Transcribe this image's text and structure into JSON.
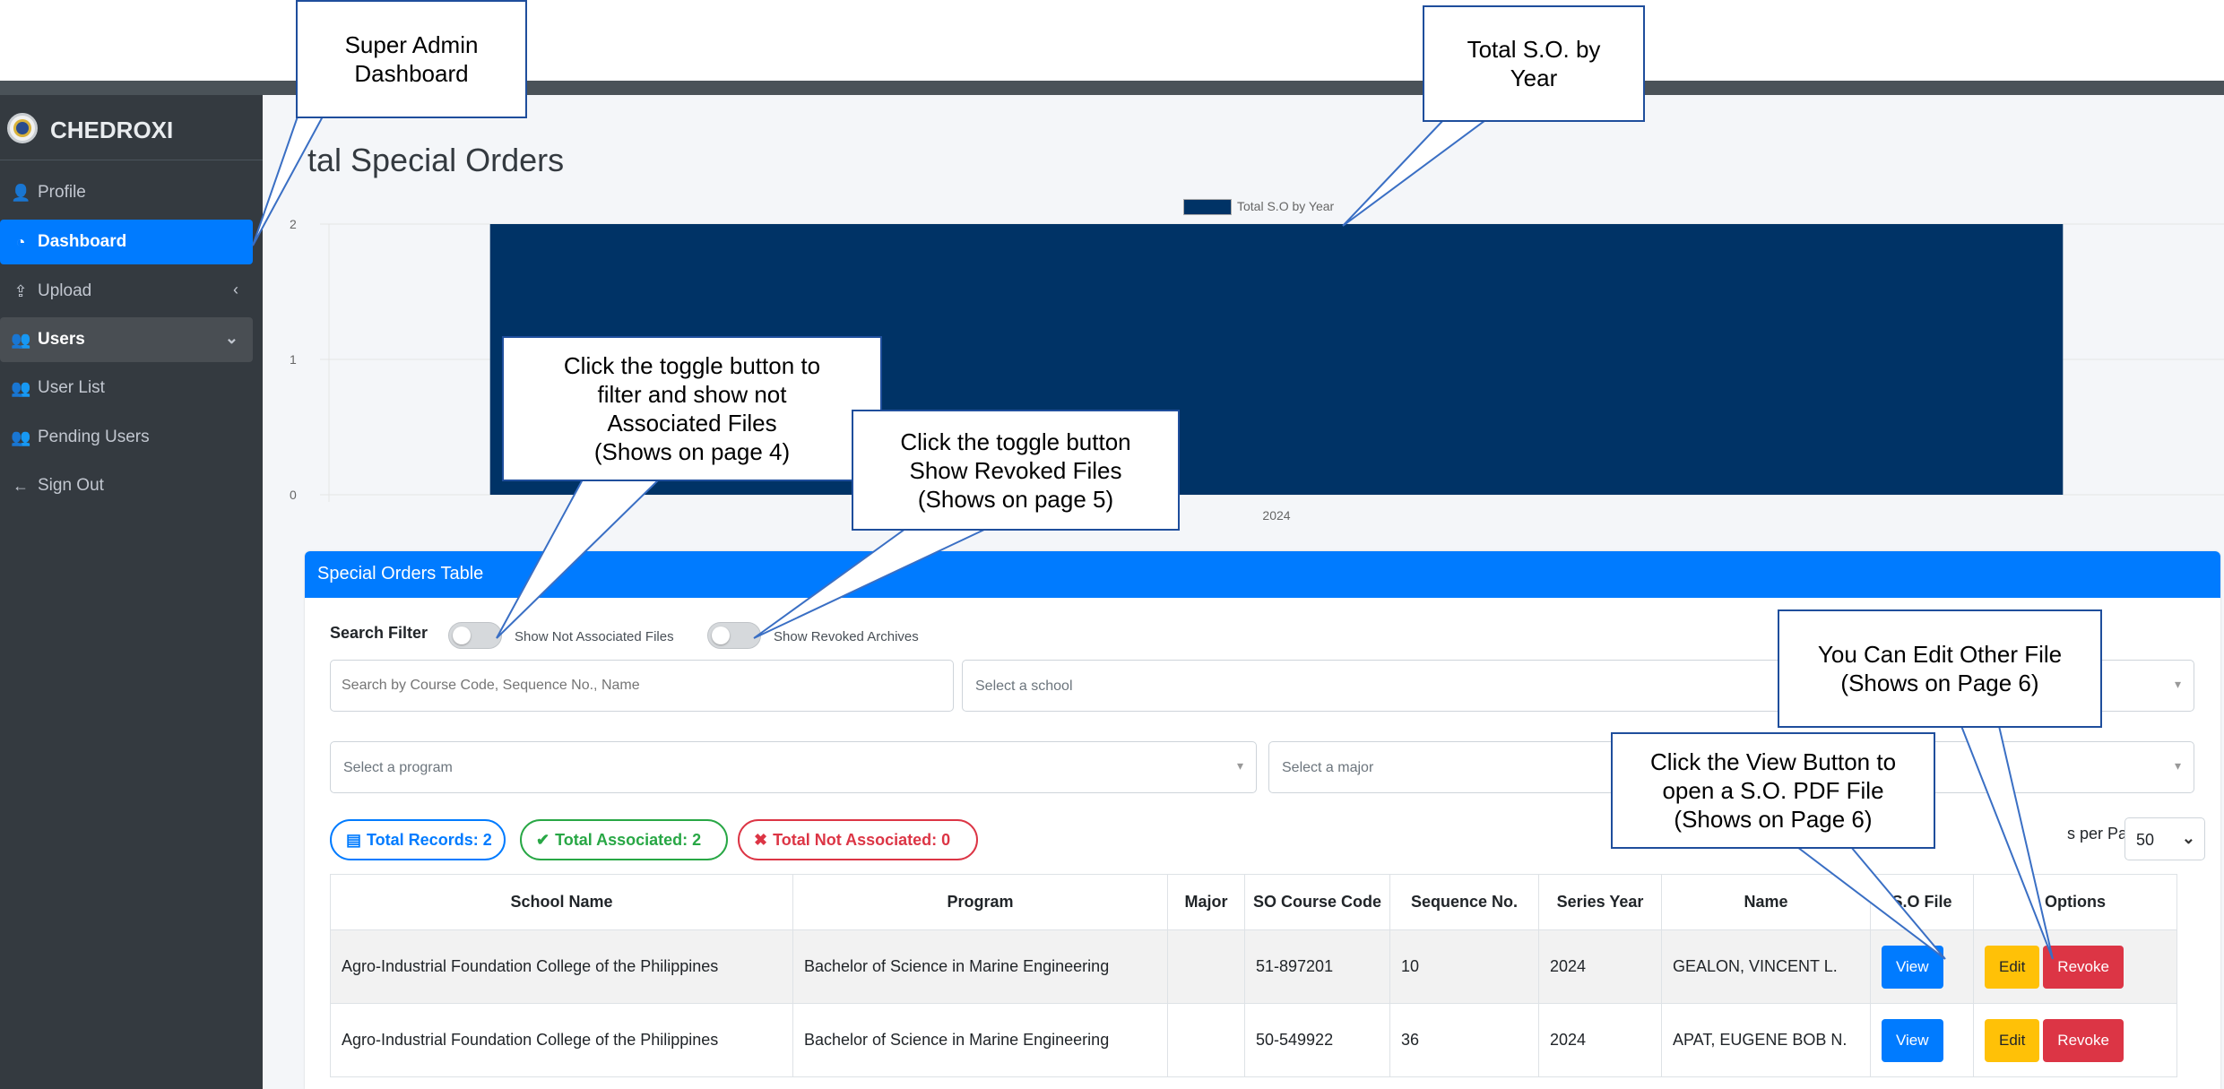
{
  "sidebar": {
    "brand": "CHEDROXI",
    "items": [
      {
        "label": "Profile",
        "icon": "user-icon",
        "glyph": "👤"
      },
      {
        "label": "Dashboard",
        "icon": "dashboard-icon",
        "glyph": "◔"
      },
      {
        "label": "Upload",
        "icon": "upload-icon",
        "glyph": "⇪"
      },
      {
        "label": "Users",
        "icon": "users-icon",
        "glyph": "👥"
      },
      {
        "label": "User List",
        "icon": "users-icon",
        "glyph": "👥"
      },
      {
        "label": "Pending Users",
        "icon": "users-icon",
        "glyph": "👥"
      },
      {
        "label": "Sign Out",
        "icon": "arrow-left-icon",
        "glyph": "←"
      }
    ]
  },
  "page": {
    "title": "tal Special Orders"
  },
  "chart_data": {
    "type": "bar",
    "categories": [
      "2024"
    ],
    "series": [
      {
        "name": "Total S.O by Year",
        "values": [
          2
        ],
        "color": "#003366"
      }
    ],
    "yticks": [
      "0",
      "1",
      "2"
    ],
    "ylim": [
      0,
      2
    ]
  },
  "card": {
    "title": "Special Orders Table"
  },
  "filters": {
    "label": "Search Filter",
    "toggle1": "Show Not Associated Files",
    "toggle2": "Show Revoked Archives",
    "search_placeholder": "Search by Course Code, Sequence No., Name",
    "school_placeholder": "Select a school",
    "program_placeholder": "Select a program",
    "major_placeholder": "Select a major"
  },
  "badges": {
    "total_records": "Total Records: 2",
    "total_associated": "Total Associated: 2",
    "total_not_associated": "Total Not Associated: 0"
  },
  "per_page": {
    "label": "s per Page:",
    "value": "50"
  },
  "table": {
    "headers": [
      "School Name",
      "Program",
      "Major",
      "SO Course Code",
      "Sequence No.",
      "Series Year",
      "Name",
      "S.O File",
      "Options"
    ],
    "rows": [
      {
        "school": "Agro-Industrial Foundation College of the Philippines",
        "program": "Bachelor of Science in Marine Engineering",
        "major": "",
        "code": "51-897201",
        "seq": "10",
        "year": "2024",
        "name": "GEALON, VINCENT L."
      },
      {
        "school": "Agro-Industrial Foundation College of the Philippines",
        "program": "Bachelor of Science in Marine Engineering",
        "major": "",
        "code": "50-549922",
        "seq": "36",
        "year": "2024",
        "name": "APAT, EUGENE BOB N."
      }
    ],
    "view_label": "View",
    "edit_label": "Edit",
    "revoke_label": "Revoke"
  },
  "callouts": {
    "dashboard": "Super Admin\nDashboard",
    "total_so": "Total S.O. by\nYear",
    "toggle_not_assoc": "Click the toggle button to\nfilter and show not\nAssociated Files\n(Shows on page 4)",
    "toggle_revoked": "Click the toggle button\nShow Revoked Files\n(Shows on page 5)",
    "edit": "You Can Edit Other File\n(Shows on Page 6)",
    "view": "Click the View Button to\nopen a S.O. PDF File\n(Shows on Page 6)"
  }
}
